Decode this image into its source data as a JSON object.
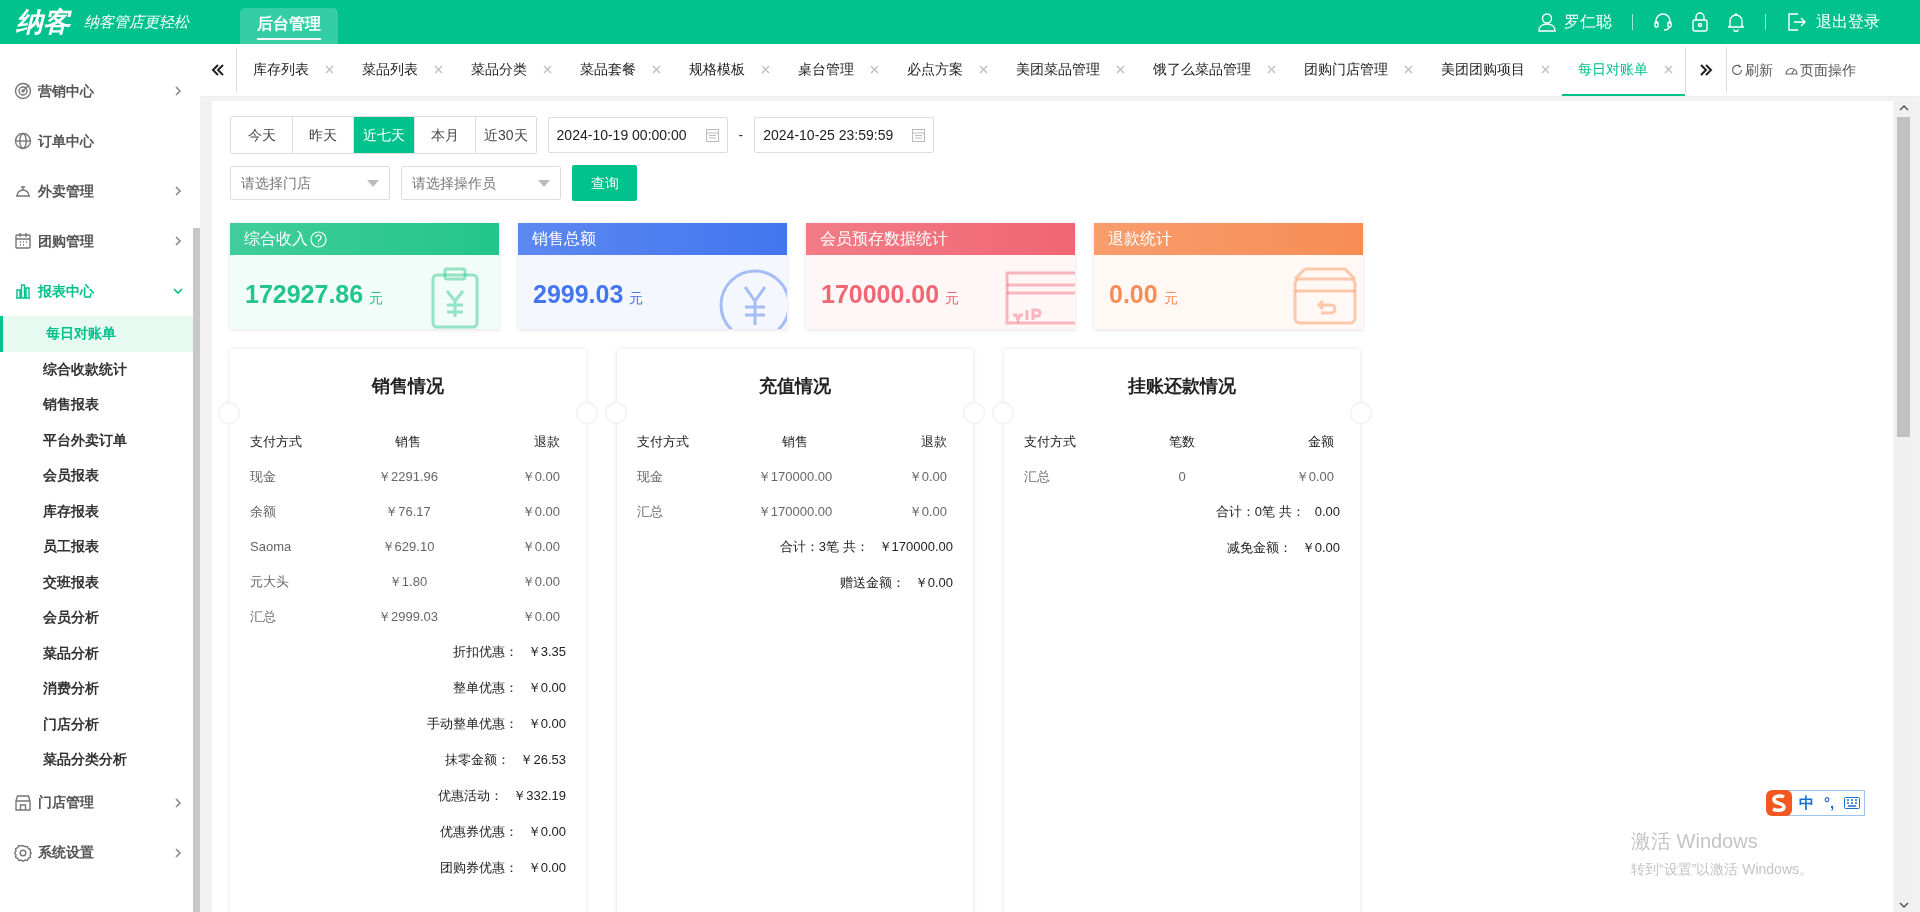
{
  "header": {
    "logo": "纳客",
    "slogan": "纳客管店更轻松",
    "nav_tab": {
      "label": "后台管理",
      "selected": true
    },
    "user_name": "罗仁聪",
    "logout": "退出登录"
  },
  "tab_bar": {
    "tabs": [
      {
        "label": "库存列表",
        "selected": false
      },
      {
        "label": "菜品列表",
        "selected": false
      },
      {
        "label": "菜品分类",
        "selected": false
      },
      {
        "label": "菜品套餐",
        "selected": false
      },
      {
        "label": "规格模板",
        "selected": false
      },
      {
        "label": "桌台管理",
        "selected": false
      },
      {
        "label": "必点方案",
        "selected": false
      },
      {
        "label": "美团菜品管理",
        "selected": false
      },
      {
        "label": "饿了么菜品管理",
        "selected": false
      },
      {
        "label": "团购门店管理",
        "selected": false
      },
      {
        "label": "美团团购项目",
        "selected": false
      },
      {
        "label": "每日对账单",
        "selected": true
      }
    ],
    "refresh": "刷新",
    "page_actions": "页面操作"
  },
  "sidebar": {
    "items": [
      {
        "label": "营销中心",
        "expandable": true,
        "expanded": false
      },
      {
        "label": "订单中心",
        "expandable": false,
        "expanded": false
      },
      {
        "label": "外卖管理",
        "expandable": true,
        "expanded": false
      },
      {
        "label": "团购管理",
        "expandable": true,
        "expanded": false
      },
      {
        "label": "报表中心",
        "expandable": true,
        "expanded": true,
        "children": [
          {
            "label": "每日对账单",
            "selected": true
          },
          {
            "label": "综合收款统计",
            "selected": false
          },
          {
            "label": "销售报表",
            "selected": false
          },
          {
            "label": "平台外卖订单",
            "selected": false
          },
          {
            "label": "会员报表",
            "selected": false
          },
          {
            "label": "库存报表",
            "selected": false
          },
          {
            "label": "员工报表",
            "selected": false
          },
          {
            "label": "交班报表",
            "selected": false
          },
          {
            "label": "会员分析",
            "selected": false
          },
          {
            "label": "菜品分析",
            "selected": false
          },
          {
            "label": "消费分析",
            "selected": false
          },
          {
            "label": "门店分析",
            "selected": false
          },
          {
            "label": "菜品分类分析",
            "selected": false
          }
        ]
      },
      {
        "label": "门店管理",
        "expandable": true,
        "expanded": false
      },
      {
        "label": "系统设置",
        "expandable": true,
        "expanded": false
      }
    ]
  },
  "filters": {
    "quick_ranges": [
      {
        "label": "今天",
        "selected": false
      },
      {
        "label": "昨天",
        "selected": false
      },
      {
        "label": "近七天",
        "selected": true
      },
      {
        "label": "本月",
        "selected": false
      },
      {
        "label": "近30天",
        "selected": false
      }
    ],
    "start_date": "2024-10-19 00:00:00",
    "separator": "-",
    "end_date": "2024-10-25 23:59:59",
    "store_select": {
      "placeholder": "请选择门店"
    },
    "operator_select": {
      "placeholder": "请选择操作员"
    },
    "query_button": "查询"
  },
  "summary_cards": [
    {
      "title": "综合收入",
      "help": true,
      "value": "172927.86",
      "unit": "元",
      "color": "#22c58b"
    },
    {
      "title": "销售总额",
      "help": false,
      "value": "2999.03",
      "unit": "元",
      "color": "#4275ee"
    },
    {
      "title": "会员预存数据统计",
      "help": false,
      "value": "170000.00",
      "unit": "元",
      "color": "#f06673"
    },
    {
      "title": "退款统计",
      "help": false,
      "value": "0.00",
      "unit": "元",
      "color": "#f78d55"
    }
  ],
  "panels": [
    {
      "title": "销售情况",
      "columns": [
        "支付方式",
        "销售",
        "退款"
      ],
      "rows": [
        [
          "现金",
          "￥2291.96",
          "￥0.00"
        ],
        [
          "余额",
          "￥76.17",
          "￥0.00"
        ],
        [
          "Saoma",
          "￥629.10",
          "￥0.00"
        ],
        [
          "元大头",
          "￥1.80",
          "￥0.00"
        ],
        [
          "汇总",
          "￥2999.03",
          "￥0.00"
        ]
      ],
      "totals": [
        {
          "label": "折扣优惠：",
          "value": "￥3.35"
        },
        {
          "label": "整单优惠：",
          "value": "￥0.00"
        },
        {
          "label": "手动整单优惠：",
          "value": "￥0.00"
        },
        {
          "label": "抹零金额：",
          "value": "￥26.53"
        },
        {
          "label": "优惠活动：",
          "value": "￥332.19"
        },
        {
          "label": "优惠券优惠：",
          "value": "￥0.00"
        },
        {
          "label": "团购券优惠：",
          "value": "￥0.00"
        }
      ]
    },
    {
      "title": "充值情况",
      "columns": [
        "支付方式",
        "销售",
        "退款"
      ],
      "rows": [
        [
          "现金",
          "￥170000.00",
          "￥0.00"
        ],
        [
          "汇总",
          "￥170000.00",
          "￥0.00"
        ]
      ],
      "totals": [
        {
          "label": "合计：3笔 共：",
          "value": "￥170000.00"
        },
        {
          "label": "赠送金额：",
          "value": "￥0.00"
        }
      ]
    },
    {
      "title": "挂账还款情况",
      "columns": [
        "支付方式",
        "笔数",
        "金额"
      ],
      "rows": [
        [
          "汇总",
          "0",
          "￥0.00"
        ]
      ],
      "totals": [
        {
          "label": "合计：0笔 共：",
          "value": "0.00"
        },
        {
          "label": "减免金额：",
          "value": "￥0.00"
        }
      ]
    }
  ],
  "ime": {
    "mode": "中",
    "punctuation": "°,"
  },
  "activation_notice": {
    "title": "激活 Windows",
    "subtitle": "转到“设置”以激活 Windows。"
  }
}
